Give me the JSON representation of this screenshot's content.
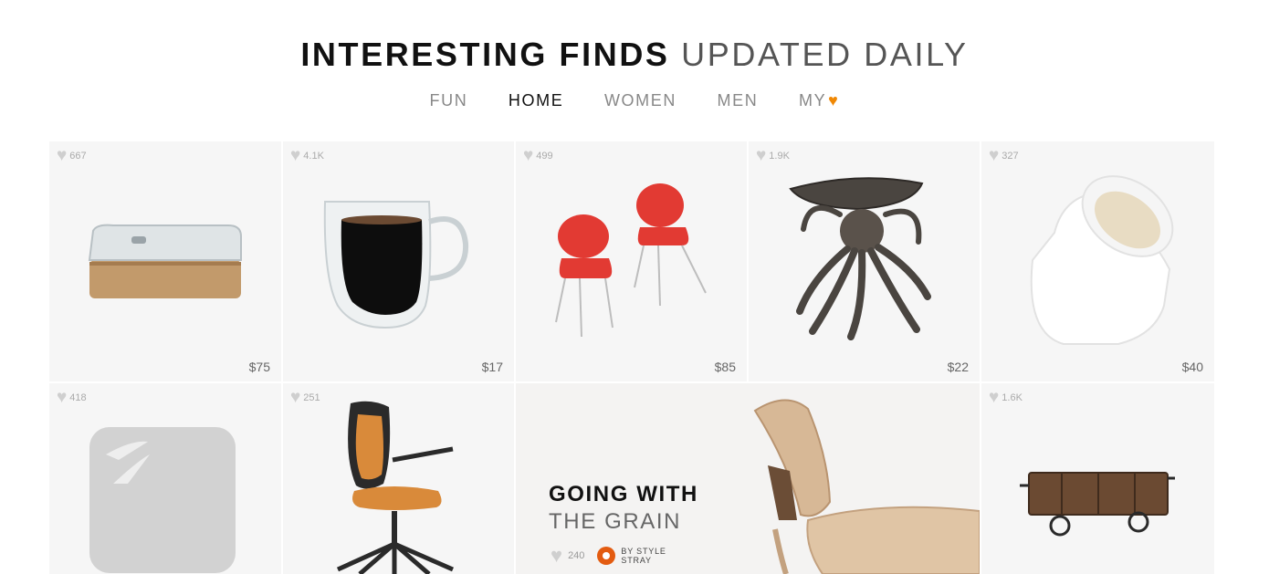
{
  "header": {
    "title_strong": "INTERESTING FINDS",
    "title_light": "UPDATED DAILY"
  },
  "nav": {
    "items": [
      "FUN",
      "HOME",
      "WOMEN",
      "MEN",
      "MY"
    ],
    "active": "HOME",
    "my_icon": "heart-icon",
    "my_icon_color": "#f08804"
  },
  "products": [
    {
      "likes": "667",
      "price": "$75",
      "item": "glass-box-icon"
    },
    {
      "likes": "4.1K",
      "price": "$17",
      "item": "coffee-mug-icon"
    },
    {
      "likes": "499",
      "price": "$85",
      "item": "red-chairs-icon"
    },
    {
      "likes": "1.9K",
      "price": "$22",
      "item": "octopus-stand-icon"
    },
    {
      "likes": "327",
      "price": "$40",
      "item": "salt-pig-icon"
    },
    {
      "likes": "418",
      "item": "tile-icon"
    },
    {
      "likes": "251",
      "item": "office-chair-icon"
    },
    {
      "likes": "1.6K",
      "item": "cart-icon"
    }
  ],
  "feature": {
    "title_line1": "GOING WITH",
    "title_line2": "THE GRAIN",
    "likes": "240",
    "brand_line1": "BY STYLE",
    "brand_line2": "STRAY",
    "brand_color": "#e35b10"
  }
}
